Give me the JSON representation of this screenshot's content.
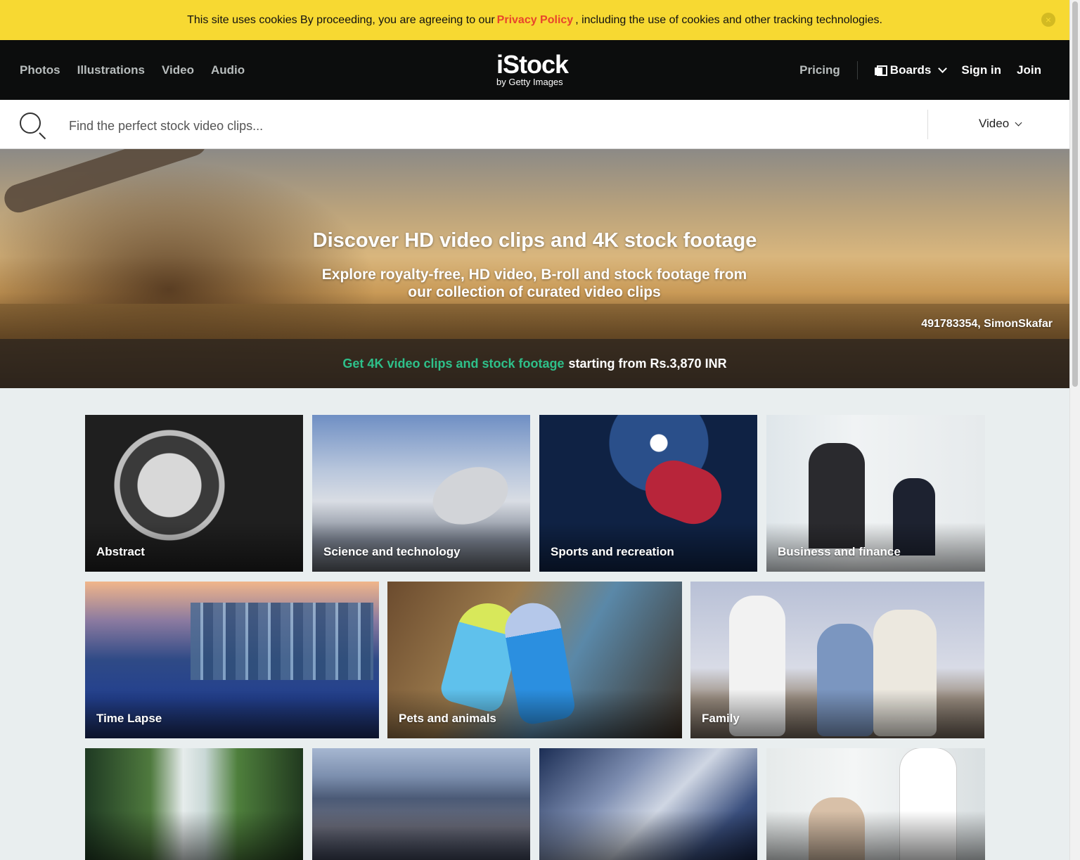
{
  "cookie_banner": {
    "text_before": "This site uses cookies By proceeding, you are agreeing to our",
    "link": "Privacy Policy",
    "text_after": ", including the use of cookies and other tracking technologies.",
    "close": "×"
  },
  "header": {
    "nav_left": [
      "Photos",
      "Illustrations",
      "Video",
      "Audio"
    ],
    "logo_main": "iStock",
    "logo_sub": "by Getty Images",
    "pricing": "Pricing",
    "boards": "Boards",
    "signin": "Sign in",
    "join": "Join"
  },
  "search": {
    "placeholder": "Find the perfect stock video clips...",
    "type": "Video"
  },
  "hero": {
    "title": "Discover HD video clips and 4K stock footage",
    "subtitle": "Explore royalty-free, HD video, B-roll and stock footage from our collection of curated video clips",
    "credit": "491783354, SimonSkafar",
    "band_link": "Get 4K video clips and stock footage",
    "band_text": "starting from Rs.3,870 INR"
  },
  "categories": [
    {
      "label": "Abstract"
    },
    {
      "label": "Science and technology"
    },
    {
      "label": "Sports and recreation"
    },
    {
      "label": "Business and finance"
    },
    {
      "label": "Time Lapse"
    },
    {
      "label": "Pets and animals"
    },
    {
      "label": "Family"
    },
    {
      "label": ""
    },
    {
      "label": ""
    },
    {
      "label": ""
    },
    {
      "label": ""
    }
  ],
  "colors": {
    "cookie_bg": "#f7d932",
    "header_bg": "#0c0d0d",
    "accent_green": "#2ec08a",
    "link_red": "#e8452c",
    "page_bg": "#e9eeef"
  }
}
